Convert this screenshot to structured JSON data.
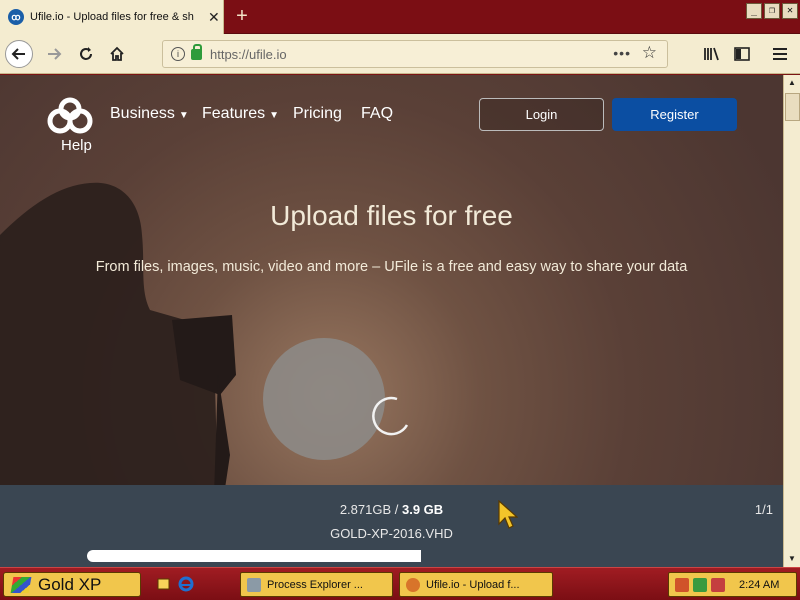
{
  "browser": {
    "tab": {
      "title": "Ufile.io - Upload files for free & sh",
      "favicon_text": "ꝏ"
    },
    "url": "https://ufile.io",
    "icons": {
      "back": "back-arrow-icon",
      "forward": "forward-arrow-icon",
      "reload": "reload-icon",
      "home": "home-icon",
      "info": "info-icon",
      "lock": "lock-icon",
      "more": "more-icon",
      "bookmark": "star-icon",
      "library": "library-icon",
      "sidebar": "sidebar-icon",
      "menu": "hamburger-menu-icon"
    }
  },
  "site": {
    "nav": {
      "help": "Help",
      "business": "Business",
      "features": "Features",
      "pricing": "Pricing",
      "faq": "FAQ",
      "login": "Login",
      "register": "Register"
    },
    "hero": {
      "title": "Upload files for free",
      "subtitle": "From files, images, music, video and more – UFile is a free and easy way to share your data"
    },
    "upload": {
      "uploaded": "2.871GB",
      "separator": " / ",
      "total": "3.9 GB",
      "filename": "GOLD-XP-2016.VHD",
      "count": "1/1",
      "progress": 0.736
    },
    "colors": {
      "register_button": "#0b4ea2",
      "upload_panel": "#3a4652"
    }
  },
  "taskbar": {
    "start_label": "Gold XP",
    "tasks": [
      {
        "label": "Process Explorer ..."
      },
      {
        "label": "Ufile.io - Upload f..."
      }
    ],
    "clock": "2:24 AM"
  }
}
